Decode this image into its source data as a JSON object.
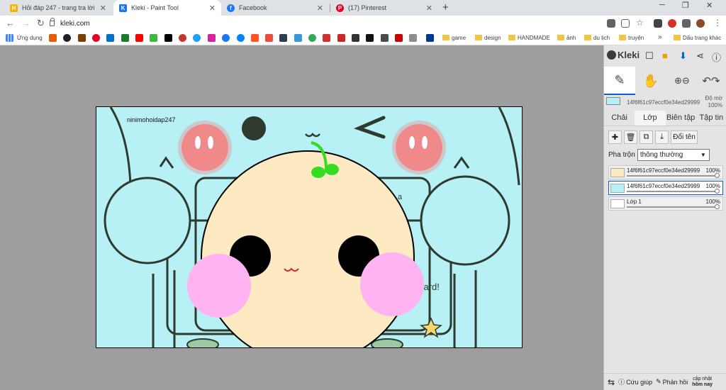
{
  "browser": {
    "tabs": [
      {
        "title": "Hỏi đáp 247 - trang tra lời",
        "favicon_color": "#f4b400"
      },
      {
        "title": "Kleki - Paint Tool",
        "favicon_color": "#1a73e8"
      },
      {
        "title": "Facebook",
        "favicon_color": "#1877f2"
      },
      {
        "title": "(17) Pinterest",
        "favicon_color": "#e60023"
      }
    ],
    "url": "kleki.com",
    "bookmarks": {
      "apps": "Ứng dụng",
      "game": "game",
      "design": "design",
      "handmade": "HANDMADE",
      "anh": "ảnh",
      "dulich": "du lịch",
      "truyen": "truyện",
      "more": "»",
      "other": "Dấu trang khác"
    }
  },
  "canvas": {
    "watermark": "ninimohoidap247"
  },
  "panel": {
    "logo": "Kleki",
    "preview_name": "14f6f61c97eccf0e34ed29999",
    "preview_opacity_label": "Độ mờ",
    "preview_opacity": "100%",
    "tabs": [
      "Chải",
      "Lớp",
      "Biên tập",
      "Tập tin"
    ],
    "rename_label": "Đổi tên",
    "blend_label": "Pha trộn",
    "blend_value": "thông thường",
    "layers": [
      {
        "name": "14f6f61c97eccf0e34ed29999",
        "opacity": "100%"
      },
      {
        "name": "14f6f61c97eccf0e34ed29999",
        "opacity": "100%"
      },
      {
        "name": "Lớp 1",
        "opacity": "100%"
      }
    ],
    "footer": {
      "help": "Cứu giúp",
      "feedback": "Phản hồi",
      "update_line1": "cập nhật",
      "update_line2": "hôm nay"
    }
  },
  "colors": {
    "accent": "#0a63c9",
    "canvas_bg": "#b7f0f5",
    "face": "#fde9c2",
    "blush": "#ffb3f0",
    "sprout": "#33dd22"
  }
}
